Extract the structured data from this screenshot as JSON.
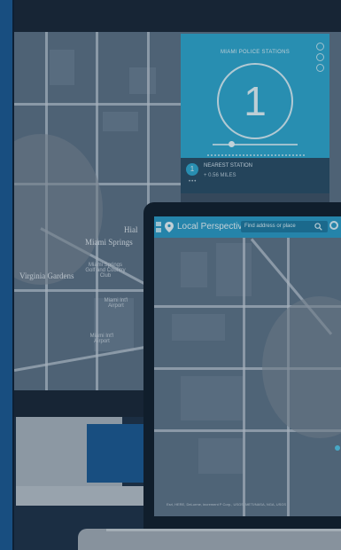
{
  "desktop_map": {
    "labels": [
      "Miami Springs",
      "Virginia Gardens",
      "Hial"
    ],
    "small_labels": [
      "Miami Springs Golf and Country Club",
      "Miami Int'l Airport",
      "Miami Int'l Airport"
    ]
  },
  "stations_panel": {
    "title": "MIAMI POLICE STATIONS",
    "count": "1",
    "result_badge": "1",
    "result_title": "NEAREST STATION",
    "result_sub": "+ 0.56 MILES",
    "result_more": "•••"
  },
  "laptop": {
    "app_name": "Local Perspective",
    "search_placeholder": "Find address or place",
    "attribution": "Esri, HERE, DeLorme, increment P Corp., USGS, METI/NASA, NGA, USGS"
  },
  "colors": {
    "accent": "#2fa8cf",
    "strip": "#1b5a93",
    "frame": "#1a2838"
  }
}
